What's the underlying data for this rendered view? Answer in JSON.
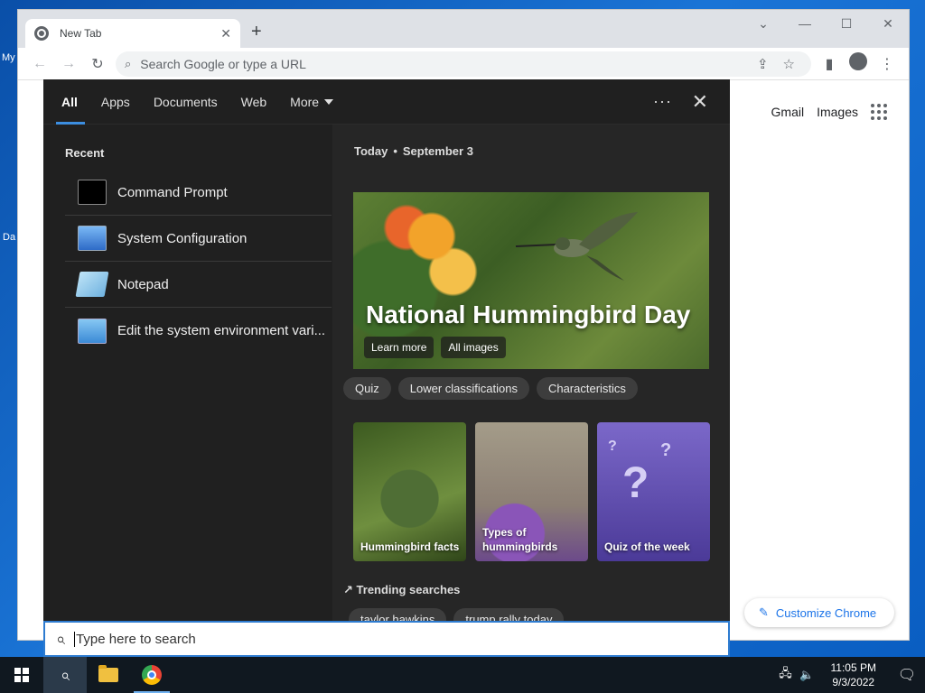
{
  "browser": {
    "tab_title": "New Tab",
    "omnibox_placeholder": "Search Google or type a URL",
    "links": [
      "Gmail",
      "Images"
    ],
    "customize_label": "Customize Chrome"
  },
  "desktop": {
    "icon_frag_1": "My",
    "icon_frag_2": "Da"
  },
  "search": {
    "tabs": [
      "All",
      "Apps",
      "Documents",
      "Web",
      "More"
    ],
    "recent_title": "Recent",
    "recent": [
      {
        "label": "Command Prompt",
        "icon": "cmd-icon"
      },
      {
        "label": "System Configuration",
        "icon": "system-config-icon"
      },
      {
        "label": "Notepad",
        "icon": "notepad-icon"
      },
      {
        "label": "Edit the system environment vari...",
        "icon": "env-vars-icon"
      }
    ],
    "today_label": "Today",
    "date": "September 3",
    "hero": {
      "title": "National Hummingbird Day",
      "btn_learn": "Learn more",
      "btn_images": "All images"
    },
    "chips": [
      "Quiz",
      "Lower classifications",
      "Characteristics"
    ],
    "cards": [
      {
        "label": "Hummingbird facts"
      },
      {
        "label": "Types of hummingbirds"
      },
      {
        "label": "Quiz of the week"
      }
    ],
    "trending_title": "Trending searches",
    "trending": [
      "taylor hawkins",
      "trump rally today"
    ],
    "box_placeholder": "Type here to search"
  },
  "taskbar": {
    "time": "11:05 PM",
    "date": "9/3/2022"
  }
}
